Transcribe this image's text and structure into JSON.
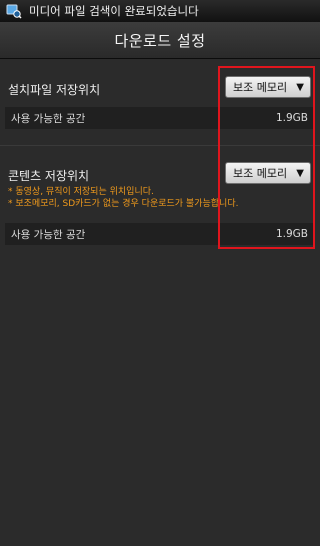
{
  "statusbar": {
    "icon": "media-scan-icon",
    "text": "미디어 파일 검색이 완료되었습니다"
  },
  "header": {
    "title": "다운로드 설정"
  },
  "install_location": {
    "label": "설치파일 저장위치",
    "selected": "보조 메모리",
    "available_label": "사용 가능한 공간",
    "available_value": "1.9GB"
  },
  "content_location": {
    "label": "콘텐츠 저장위치",
    "selected": "보조 메모리",
    "notes": [
      "* 동영상, 뮤직이 저장되는 위치입니다.",
      "* 보조메모리, SD카드가 없는 경우 다운로드가 불가능합니다."
    ],
    "available_label": "사용 가능한 공간",
    "available_value": "1.9GB"
  },
  "colors": {
    "note_text": "#f09a1c",
    "highlight_border": "#e0151d"
  }
}
